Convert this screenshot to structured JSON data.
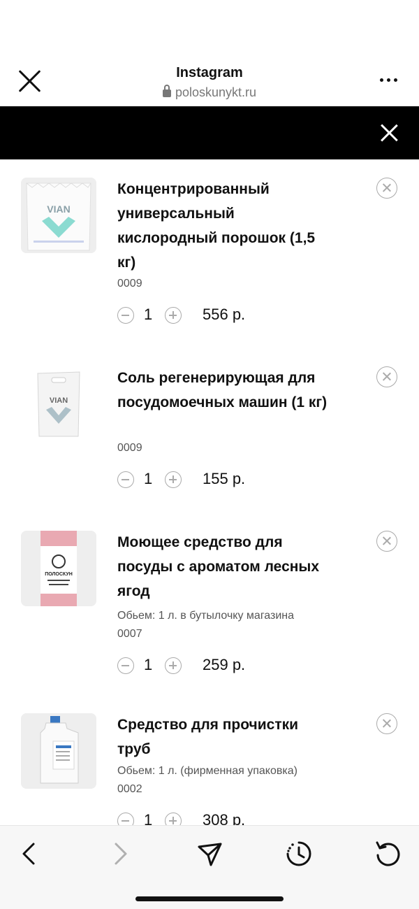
{
  "browser": {
    "title": "Instagram",
    "url": "poloskunykt.ru"
  },
  "cart": {
    "items": [
      {
        "title": "Концентрированный универсальный кислородный порошок (1,5 кг)",
        "option": "",
        "sku": "0009",
        "quantity": "1",
        "price": "556 р.",
        "image_brand": "VIAN"
      },
      {
        "title": "Соль регенерирующая для посудомоечных машин (1 кг)",
        "option": "",
        "sku": "0009",
        "quantity": "1",
        "price": "155 р.",
        "image_brand": "VIAN"
      },
      {
        "title": "Моющее средство для посуды с ароматом лесных ягод",
        "option": "Обьем: 1 л. в бутылочку магазина",
        "sku": "0007",
        "quantity": "1",
        "price": "259 р.",
        "image_brand": "ПОЛОСКУН"
      },
      {
        "title": "Средство для прочистки труб",
        "option": "Обьем: 1 л. (фирменная упаковка)",
        "sku": "0002",
        "quantity": "1",
        "price": "308 р.",
        "image_brand": ""
      }
    ]
  },
  "toolbar": {
    "icons": [
      "back-arrow-icon",
      "forward-arrow-icon",
      "share-send-icon",
      "history-clock-icon",
      "reload-icon"
    ]
  },
  "colors": {
    "bar": "#000000",
    "toolbar": "#f7f7f7",
    "disabled": "#b0b0b0"
  }
}
